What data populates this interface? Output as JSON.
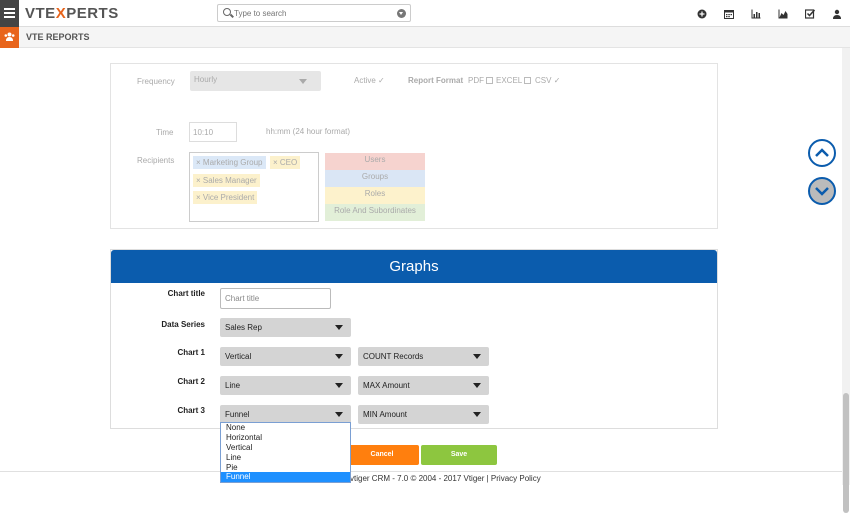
{
  "header": {
    "logo_main": "VTE",
    "logo_x": "X",
    "logo_rest": "PERTS",
    "search_placeholder": "Type to search",
    "icons": [
      "plus-circle-icon",
      "calendar-icon",
      "bar-chart-icon",
      "area-chart-icon",
      "checkbox-icon",
      "user-icon"
    ]
  },
  "module": {
    "title": "VTE REPORTS"
  },
  "schedule": {
    "frequency_label": "Frequency",
    "frequency_value": "Hourly",
    "active_label": "Active",
    "report_format_label": "Report Format",
    "formats": [
      "PDF",
      "EXCEL",
      "CSV"
    ],
    "time_label": "Time",
    "time_value": "10:10",
    "time_hint": "hh:mm (24 hour format)",
    "recipients_label": "Recipients",
    "recipient_tags": [
      "Marketing Group",
      "CEO",
      "Sales Manager",
      "Vice President"
    ],
    "recipient_types": [
      "Users",
      "Groups",
      "Roles",
      "Role And Subordinates"
    ]
  },
  "graphs": {
    "heading": "Graphs",
    "chart_title_label": "Chart title",
    "chart_title_placeholder": "Chart title",
    "data_series_label": "Data Series",
    "data_series_value": "Sales Rep",
    "chart1_label": "Chart 1",
    "chart1_type": "Vertical",
    "chart1_measure": "COUNT Records",
    "chart2_label": "Chart 2",
    "chart2_type": "Line",
    "chart2_measure": "MAX Amount",
    "chart3_label": "Chart 3",
    "chart3_type": "Funnel",
    "chart3_measure": "MIN Amount",
    "chart3_options": [
      "None",
      "Horizontal",
      "Vertical",
      "Line",
      "Pie",
      "Funnel"
    ],
    "chart3_selected_index": 5
  },
  "actions": {
    "cancel": "Cancel",
    "save": "Save"
  },
  "footer": {
    "text": "vtiger CRM - 7.0  © 2004 - 2017  Vtiger |  Privacy Policy"
  },
  "colors": {
    "brand_orange": "#e8641b",
    "header_blue": "#0b5cad",
    "cancel": "#ff7f0e",
    "save": "#8dc63f"
  }
}
